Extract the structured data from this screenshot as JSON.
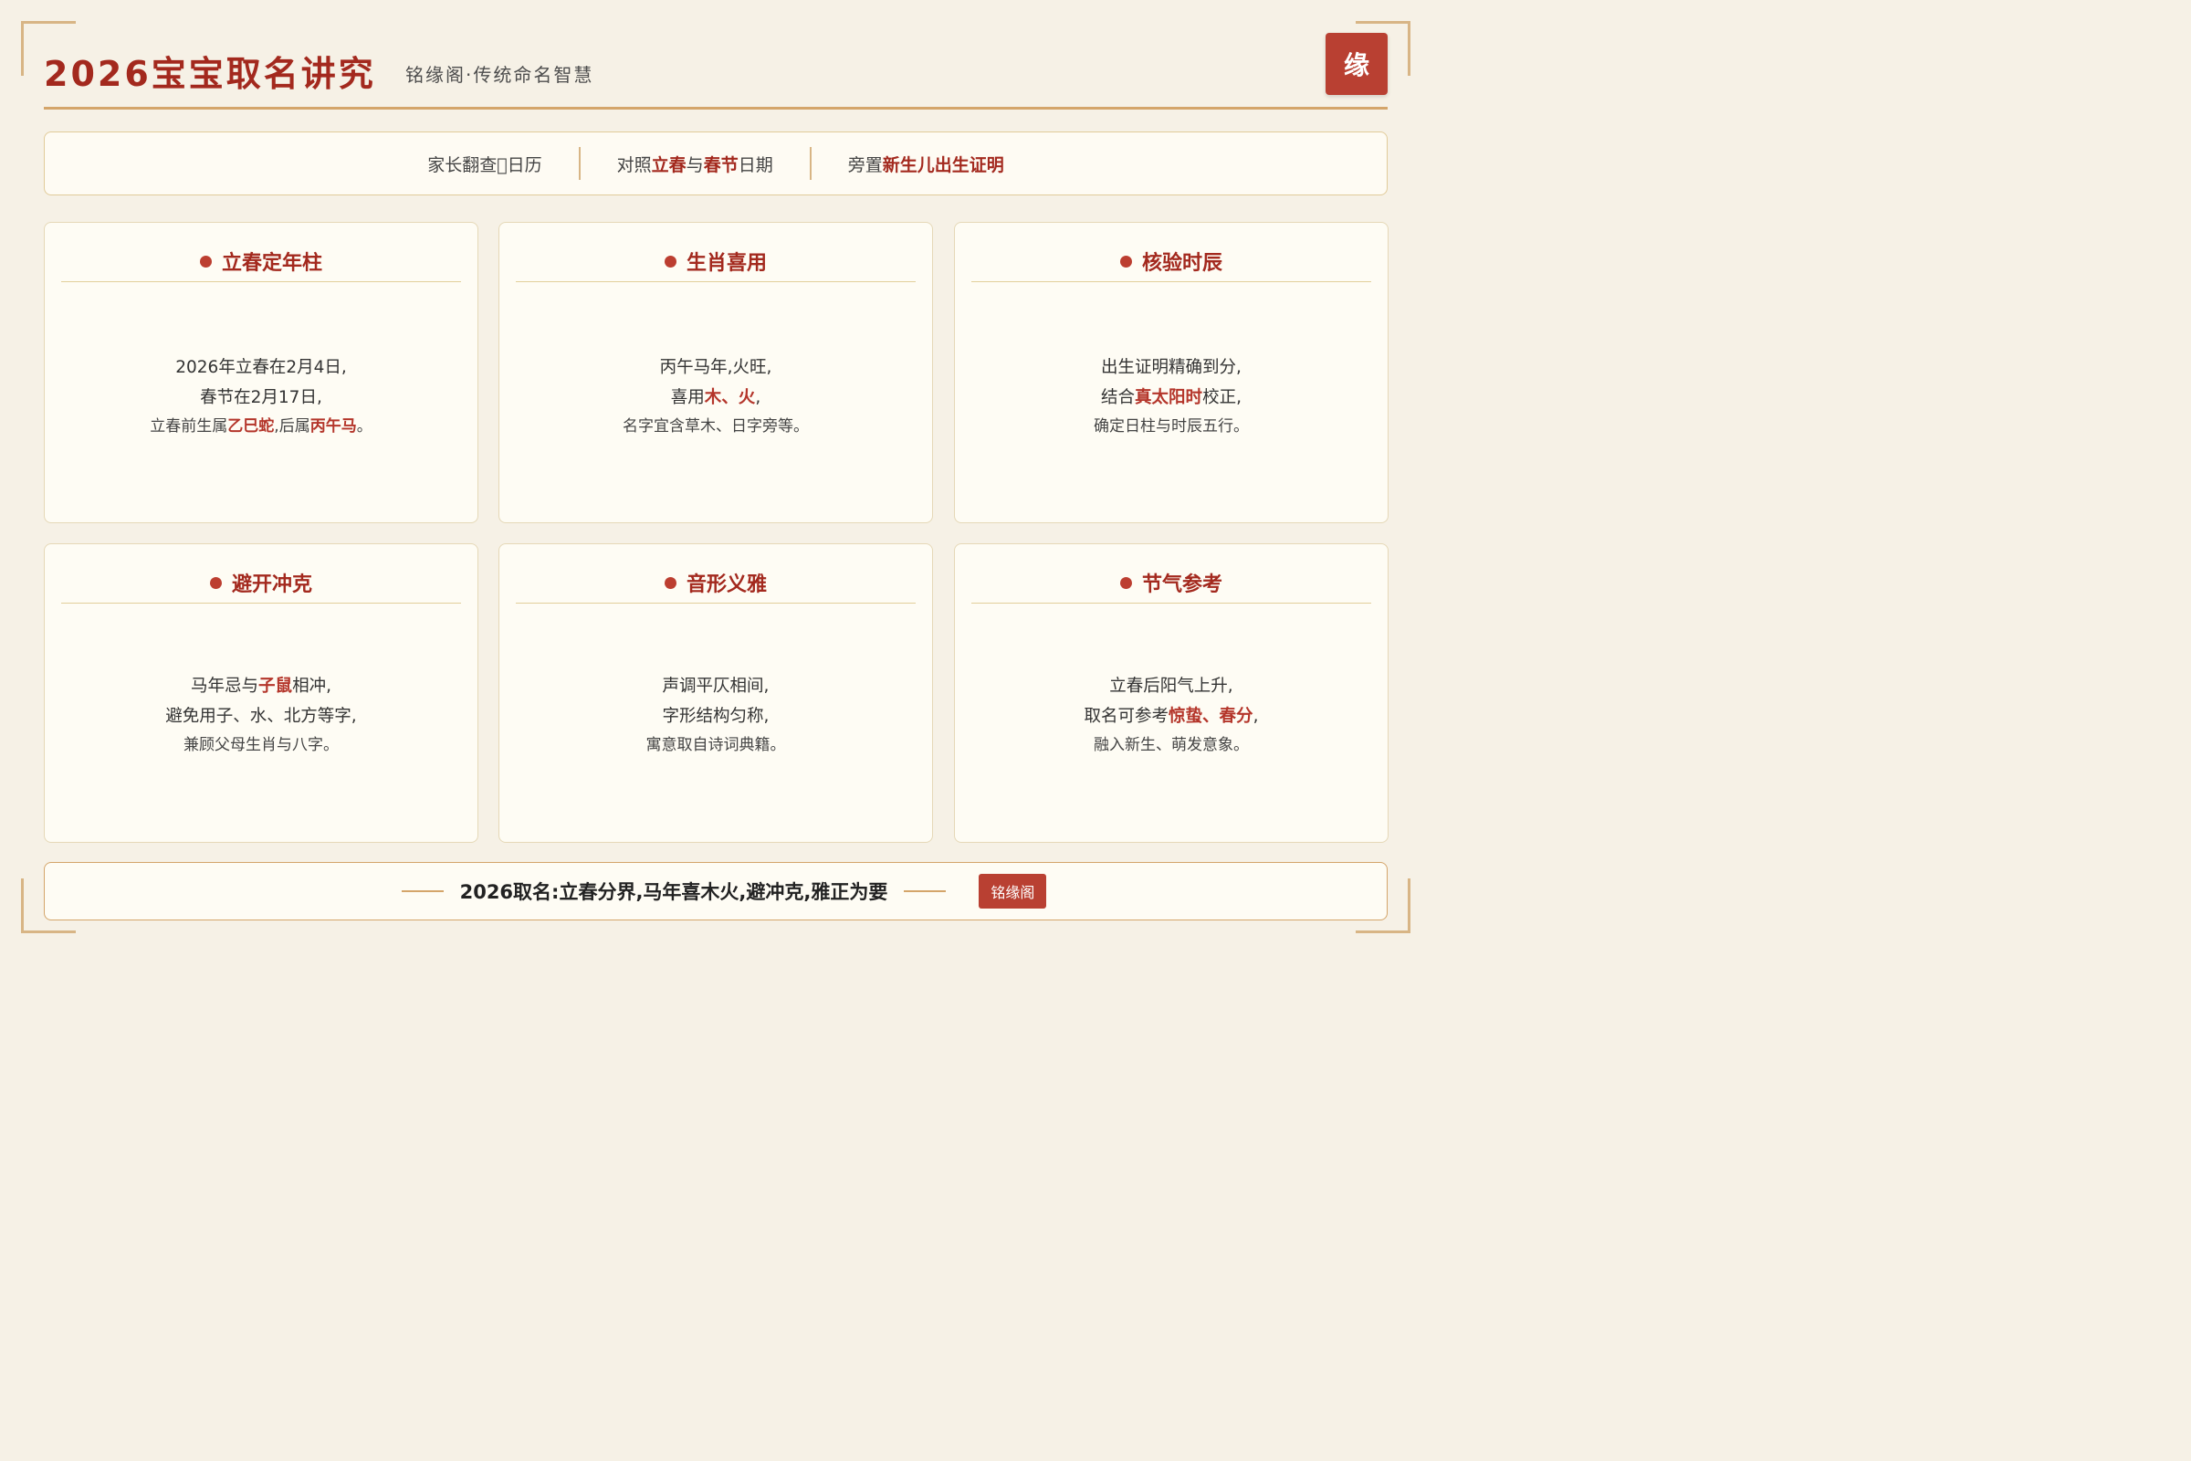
{
  "header": {
    "title": "2026宝宝取名讲究",
    "subtitle": "铭缘阁·传统命名智慧",
    "seal": "缘"
  },
  "infobar": {
    "item1": "家长翻查\u0000日历",
    "item2": {
      "t1": "对照",
      "h1": "立春",
      "t2": "与",
      "h2": "春节",
      "t3": "日期"
    },
    "item3": {
      "t1": "旁置",
      "h1": "新生儿出生证明"
    }
  },
  "cards": [
    {
      "title": "立春定年柱",
      "line1": "2026年立春在2月4日,",
      "line2": "春节在2月17日,",
      "line3": {
        "t1": "立春前生属",
        "r1": "乙巳蛇",
        "t2": ",后属",
        "r2": "丙午马",
        "t3": "。"
      }
    },
    {
      "title": "生肖喜用",
      "line1": "丙午马年,火旺,",
      "line2": {
        "t1": "喜用",
        "r1": "木、火",
        "t2": ","
      },
      "line3": "名字宜含草木、日字旁等。"
    },
    {
      "title": "核验时辰",
      "line1": "出生证明精确到分,",
      "line2": {
        "t1": "结合",
        "r1": "真太阳时",
        "t2": "校正,"
      },
      "line3": "确定日柱与时辰五行。"
    },
    {
      "title": "避开冲克",
      "line1": {
        "t1": "马年忌与",
        "r1": "子鼠",
        "t2": "相冲,"
      },
      "line2": "避免用子、水、北方等字,",
      "line3": "兼顾父母生肖与八字。"
    },
    {
      "title": "音形义雅",
      "line1": "声调平仄相间,",
      "line2": "字形结构匀称,",
      "line3": "寓意取自诗词典籍。"
    },
    {
      "title": "节气参考",
      "line1": "立春后阳气上升,",
      "line2": {
        "t1": "取名可参考",
        "r1": "惊蛰、春分",
        "t2": ","
      },
      "line3": "融入新生、萌发意象。"
    }
  ],
  "footer": {
    "text": "2026取名:立春分界,马年喜木火,避冲克,雅正为要",
    "badge": "铭缘阁"
  },
  "colors": {
    "accent": "#a3291e",
    "seal": "#b94032",
    "gold": "#d4a56a",
    "background": "#f6f1e6"
  }
}
